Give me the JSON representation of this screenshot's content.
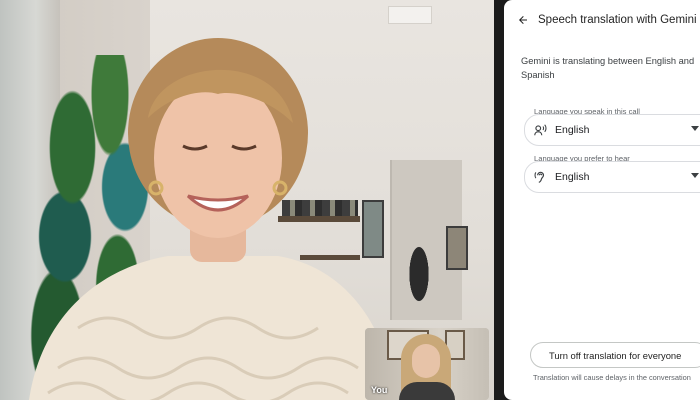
{
  "panel": {
    "title": "Speech translation with Gemini",
    "description": "Gemini is translating between English and Spanish",
    "speak_label": "Language you speak in this call",
    "speak_value": "English",
    "hear_label": "Language you prefer to hear",
    "hear_value": "English",
    "turn_off_label": "Turn off translation for everyone",
    "footnote": "Translation will cause delays in the conversation"
  },
  "self_view": {
    "label": "You"
  },
  "icons": {
    "back": "arrow-back-icon",
    "speak": "voice-speaking-icon",
    "hear": "hearing-icon",
    "caret": "dropdown-caret-icon"
  },
  "colors": {
    "panel_bg": "#ffffff",
    "text_primary": "#1f1f1f",
    "text_secondary": "#5f6368",
    "border": "#dadce0",
    "background_dark": "#1b1b1b"
  }
}
